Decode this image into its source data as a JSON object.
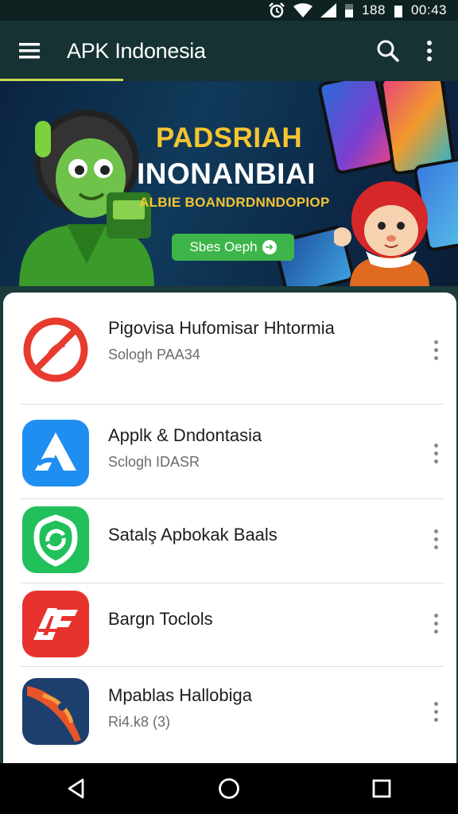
{
  "status_bar": {
    "time": "00:43",
    "battery_text": "188",
    "icons": [
      "alarm-icon",
      "wifi-icon",
      "signal-icon",
      "battery-icon"
    ]
  },
  "app_bar": {
    "title": "APK Indonesia",
    "icons": [
      "menu-icon",
      "search-icon",
      "more-vert-icon"
    ]
  },
  "banner": {
    "headline_1": "PADSRIAH",
    "headline_2": "INONANBIAI",
    "headline_3": "ALBIE BOANDRDNNDOPIOP",
    "cta_label": "Sbes Oeph"
  },
  "apps": [
    {
      "name": "Pigovisa Hufomisar Hhtormia",
      "subtitle": "Sologh PAA34",
      "icon": "blocked-tool-icon",
      "color": "#e63b2e"
    },
    {
      "name": "Applk & Dndontasia",
      "subtitle": "Sclogh IDASR",
      "icon": "triangle-a-icon",
      "color": "#1f8ef1"
    },
    {
      "name": "Satalş Apbokak Baals",
      "subtitle": "",
      "icon": "refresh-shield-icon",
      "color": "#21c05a"
    },
    {
      "name": "Bargn Toclols",
      "subtitle": "",
      "icon": "af-logo-icon",
      "color": "#e7322d"
    },
    {
      "name": "Mpablas Hallobiga",
      "subtitle": "Ri4.k8 (3)",
      "icon": "wing-logo-icon",
      "color": "#1d3f6e"
    }
  ],
  "nav_bar": {
    "icons": [
      "back-icon",
      "home-icon",
      "recents-icon"
    ]
  }
}
